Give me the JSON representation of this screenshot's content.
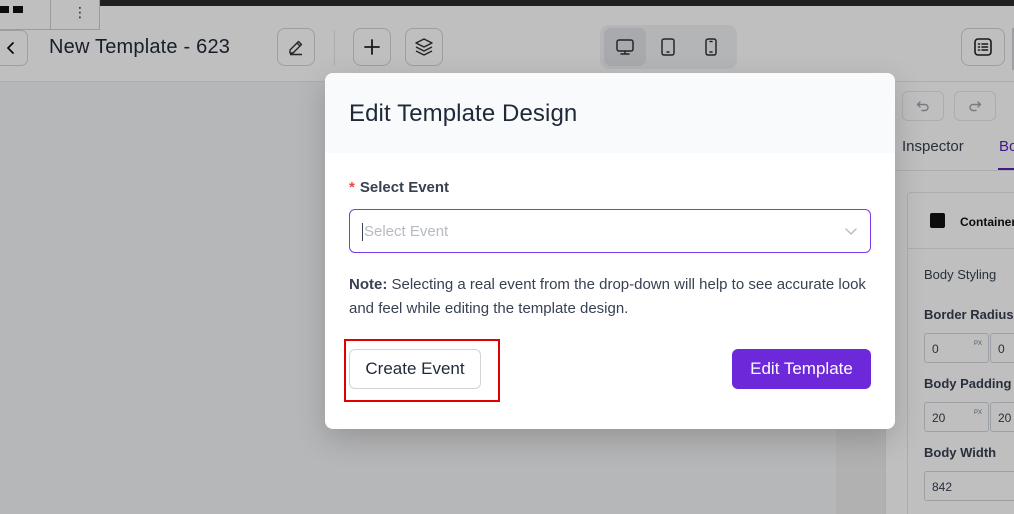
{
  "header": {
    "title": "New Template - 623",
    "kebab": "⋮"
  },
  "right_panel": {
    "tab_inspector": "Inspector",
    "tab_body": "Bo",
    "container_label": "Container",
    "body_styling": "Body Styling",
    "border_radius_label": "Border Radius",
    "border_radius_value": "0",
    "border_radius_value_2": "0",
    "body_padding_label": "Body Padding",
    "body_padding_value": "20",
    "body_padding_value_2": "20",
    "body_width_label": "Body Width",
    "body_width_value": "842",
    "unit": "PX"
  },
  "modal": {
    "title": "Edit Template Design",
    "required_mark": "*",
    "field_label": "Select Event",
    "select_placeholder": "Select Event",
    "note_label": "Note:",
    "note_text": " Selecting a real event from the drop-down will help to see accurate look and feel while editing the template design.",
    "create_button": "Create Event",
    "edit_button": "Edit Template"
  },
  "colors": {
    "accent": "#6d28d9",
    "highlight": "#e00000",
    "required": "#ef4444"
  }
}
